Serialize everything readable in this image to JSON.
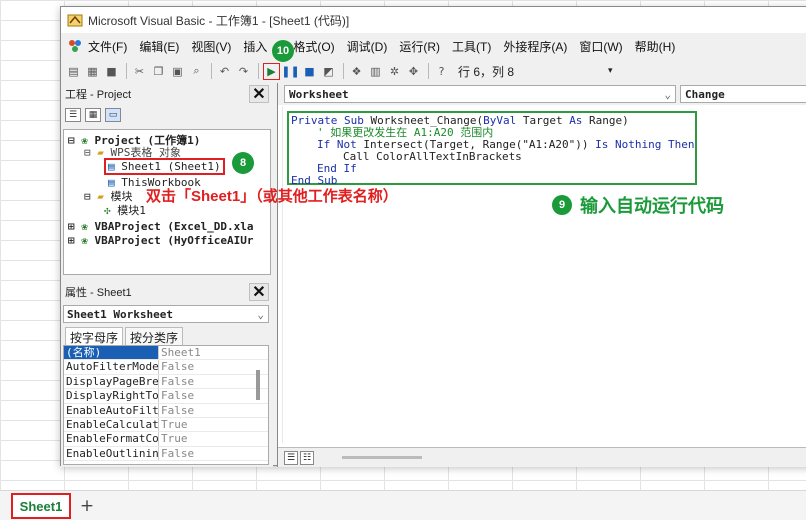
{
  "window": {
    "title": "Microsoft Visual Basic - 工作簿1 - [Sheet1 (代码)]"
  },
  "menu": {
    "items": [
      {
        "label": "文件(F)"
      },
      {
        "label": "编辑(E)"
      },
      {
        "label": "视图(V)"
      },
      {
        "label": "插入"
      },
      {
        "label": "格式(O)"
      },
      {
        "label": "调试(D)"
      },
      {
        "label": "运行(R)"
      },
      {
        "label": "工具(T)"
      },
      {
        "label": "外接程序(A)"
      },
      {
        "label": "窗口(W)"
      },
      {
        "label": "帮助(H)"
      }
    ]
  },
  "toolbar": {
    "status": "行 6，列 8"
  },
  "project": {
    "header": "工程 - Project",
    "tree": [
      {
        "text": "Project (工作簿1)",
        "bold": true
      },
      {
        "text": "WPS表格 对象"
      },
      {
        "text": "Sheet1 (Sheet1)"
      },
      {
        "text": "ThisWorkbook"
      },
      {
        "text": "模块"
      },
      {
        "text": "模块1"
      },
      {
        "text": "VBAProject (Excel_DD.xla",
        "bold": true
      },
      {
        "text": "VBAProject (HyOfficeAIUr",
        "bold": true
      }
    ]
  },
  "properties": {
    "header": "属性 - Sheet1",
    "object": "Sheet1 Worksheet",
    "tabs": [
      "按字母序",
      "按分类序"
    ],
    "rows": [
      {
        "key": "(名称)",
        "value": "Sheet1"
      },
      {
        "key": "AutoFilterMode",
        "value": "False"
      },
      {
        "key": "DisplayPageBre",
        "value": "False"
      },
      {
        "key": "DisplayRightTol",
        "value": "False"
      },
      {
        "key": "EnableAutoFilt",
        "value": "False"
      },
      {
        "key": "EnableCalculat",
        "value": "True"
      },
      {
        "key": "EnableFormatCo",
        "value": "True"
      },
      {
        "key": "EnableOutlinin",
        "value": "False"
      }
    ]
  },
  "code": {
    "object_combo": "Worksheet",
    "proc_combo": "Change",
    "lines": {
      "l1a": "Private Sub ",
      "l1b": "Worksheet_Change(",
      "l1c": "ByVal",
      "l1d": " Target ",
      "l1e": "As",
      "l1f": " Range)",
      "l2": "' 如果更改发生在 A1:A20 范围内",
      "l3a": "If Not",
      "l3b": " Intersect(Target, Range(\"A1:A20\")) ",
      "l3c": "Is Nothing Then",
      "l4": "Call ColorAllTextInBrackets",
      "l5": "End If",
      "l6": "End Sub"
    }
  },
  "annotations": {
    "badge_run": "10",
    "badge_sheet": "8",
    "badge_code": "9",
    "double_click": "双击「Sheet1」（或其他工作表名称）",
    "enter_code": "输入自动运行代码"
  },
  "sheet_tabs": {
    "active": "Sheet1",
    "add": "+"
  }
}
